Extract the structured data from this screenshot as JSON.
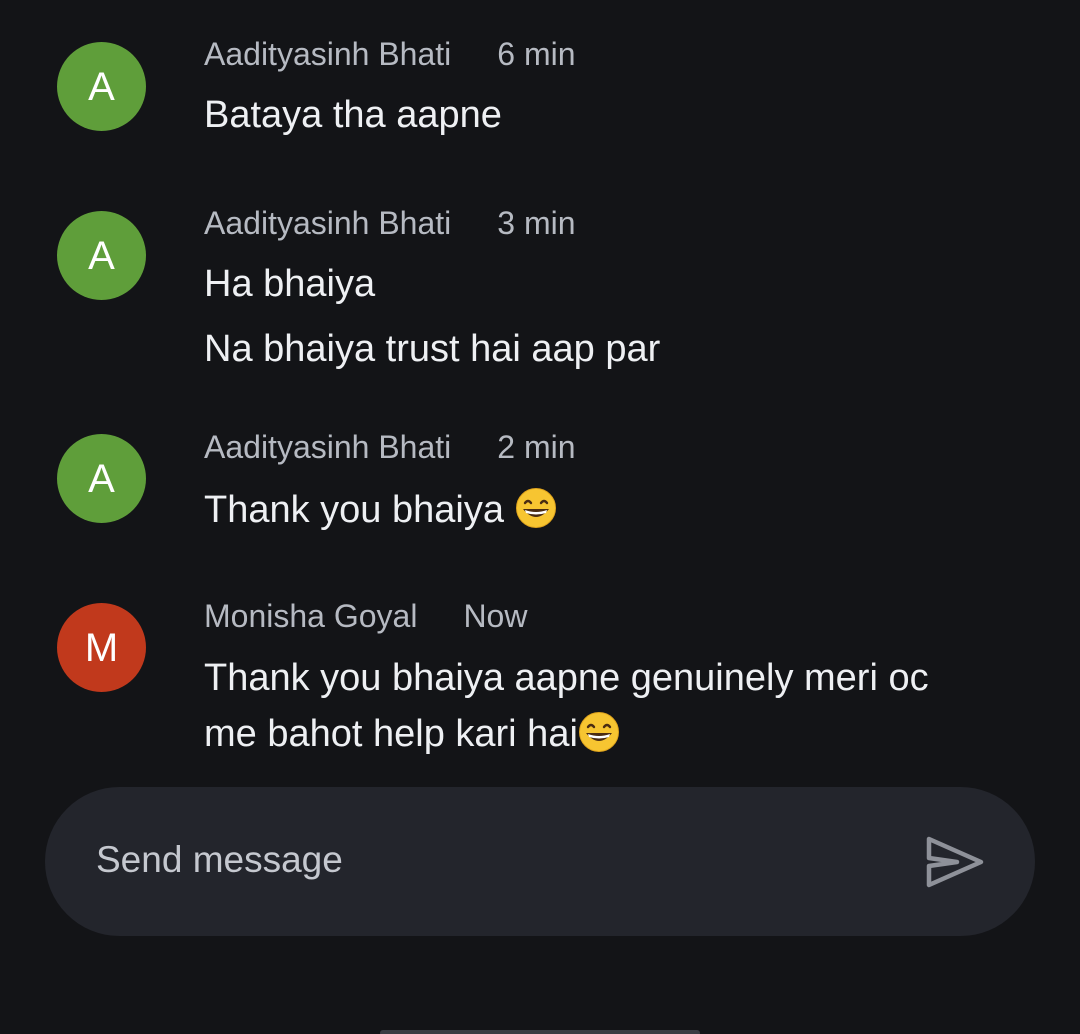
{
  "messages": [
    {
      "avatar_letter": "A",
      "sender": "Aadityasinh Bhati",
      "time": "6 min",
      "lines": [
        "Bataya tha aapne"
      ]
    },
    {
      "avatar_letter": "A",
      "sender": "Aadityasinh Bhati",
      "time": "3 min",
      "lines": [
        "Ha bhaiya",
        "Na bhaiya trust hai aap par"
      ]
    },
    {
      "avatar_letter": "A",
      "sender": "Aadityasinh Bhati",
      "time": "2 min",
      "lines": [
        "Thank you bhaiya "
      ]
    },
    {
      "avatar_letter": "M",
      "sender": "Monisha Goyal",
      "time": "Now",
      "lines": [
        "Thank you bhaiya aapne genuinely meri oc",
        "me bahot help kari hai"
      ]
    }
  ],
  "composer": {
    "placeholder": "Send message"
  },
  "colors": {
    "background": "#131417",
    "avatar_a": "#5f9e3a",
    "avatar_m": "#c1391c",
    "composer": "#23252c"
  },
  "icons": {
    "send": "send-icon",
    "emoji": "grinning-face-icon"
  }
}
